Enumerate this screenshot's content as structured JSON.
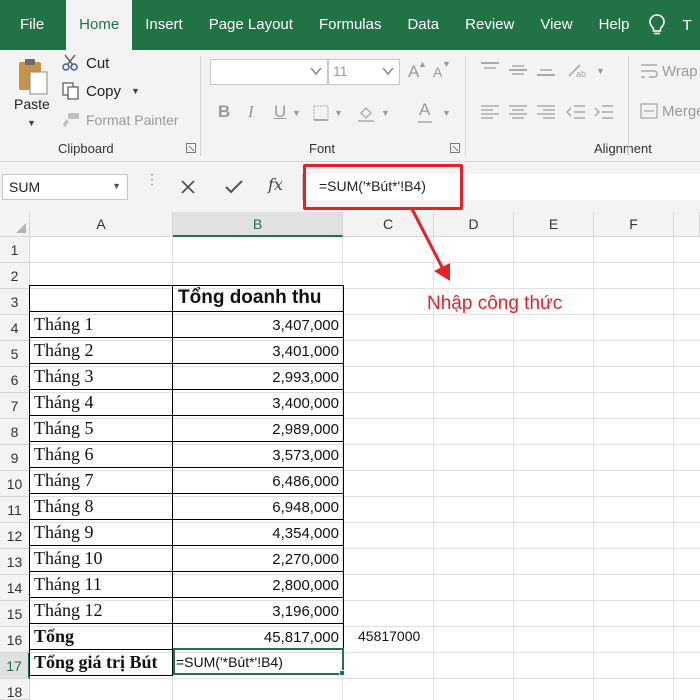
{
  "menu": {
    "tabs": [
      "File",
      "Home",
      "Insert",
      "Page Layout",
      "Formulas",
      "Data",
      "Review",
      "View",
      "Help"
    ],
    "active_tab": "Home",
    "overflow_letter": "T"
  },
  "ribbon": {
    "clipboard": {
      "paste_label": "Paste",
      "cut_label": "Cut",
      "copy_label": "Copy",
      "format_painter_label": "Format Painter",
      "group_label": "Clipboard"
    },
    "font": {
      "font_name": "",
      "font_size": "11",
      "bold_glyph": "B",
      "italic_glyph": "I",
      "underline_glyph": "U",
      "grow_glyph": "A",
      "shrink_glyph": "A",
      "font_color_glyph": "A",
      "group_label": "Font"
    },
    "alignment": {
      "wrap_label": "Wrap",
      "merge_label": "Merge",
      "group_label": "Alignment"
    }
  },
  "formula_bar": {
    "name_box": "SUM",
    "fx_label": "fx",
    "formula": "=SUM('*Bút*'!B4)"
  },
  "grid": {
    "columns": [
      "A",
      "B",
      "C",
      "D",
      "E",
      "F"
    ],
    "selected_column": "B",
    "rows": [
      "1",
      "2",
      "3",
      "4",
      "5",
      "6",
      "7",
      "8",
      "9",
      "10",
      "11",
      "12",
      "13",
      "14",
      "15",
      "16",
      "17",
      "18"
    ],
    "selected_row": "17",
    "table_header": "Tổng doanh thu",
    "months": [
      {
        "label": "Tháng 1",
        "value": "3,407,000"
      },
      {
        "label": "Tháng 2",
        "value": "3,401,000"
      },
      {
        "label": "Tháng 3",
        "value": "2,993,000"
      },
      {
        "label": "Tháng 4",
        "value": "3,400,000"
      },
      {
        "label": "Tháng 5",
        "value": "2,989,000"
      },
      {
        "label": "Tháng 6",
        "value": "3,573,000"
      },
      {
        "label": "Tháng 7",
        "value": "6,486,000"
      },
      {
        "label": "Tháng 8",
        "value": "6,948,000"
      },
      {
        "label": "Tháng 9",
        "value": "4,354,000"
      },
      {
        "label": "Tháng 10",
        "value": "2,270,000"
      },
      {
        "label": "Tháng 11",
        "value": "2,800,000"
      },
      {
        "label": "Tháng 12",
        "value": "3,196,000"
      }
    ],
    "total_label": "Tổng",
    "total_value": "45,817,000",
    "total_c_value": "45817000",
    "pen_total_label": "Tổng giá trị Bút",
    "pen_total_formula": "=SUM('*Bút*'!B4)"
  },
  "annotation": {
    "text": "Nhập công thức",
    "color": "#e32128"
  },
  "colors": {
    "excel_green": "#217346",
    "ribbon_bg": "#f3f3f3",
    "highlight_red": "#e32128"
  }
}
